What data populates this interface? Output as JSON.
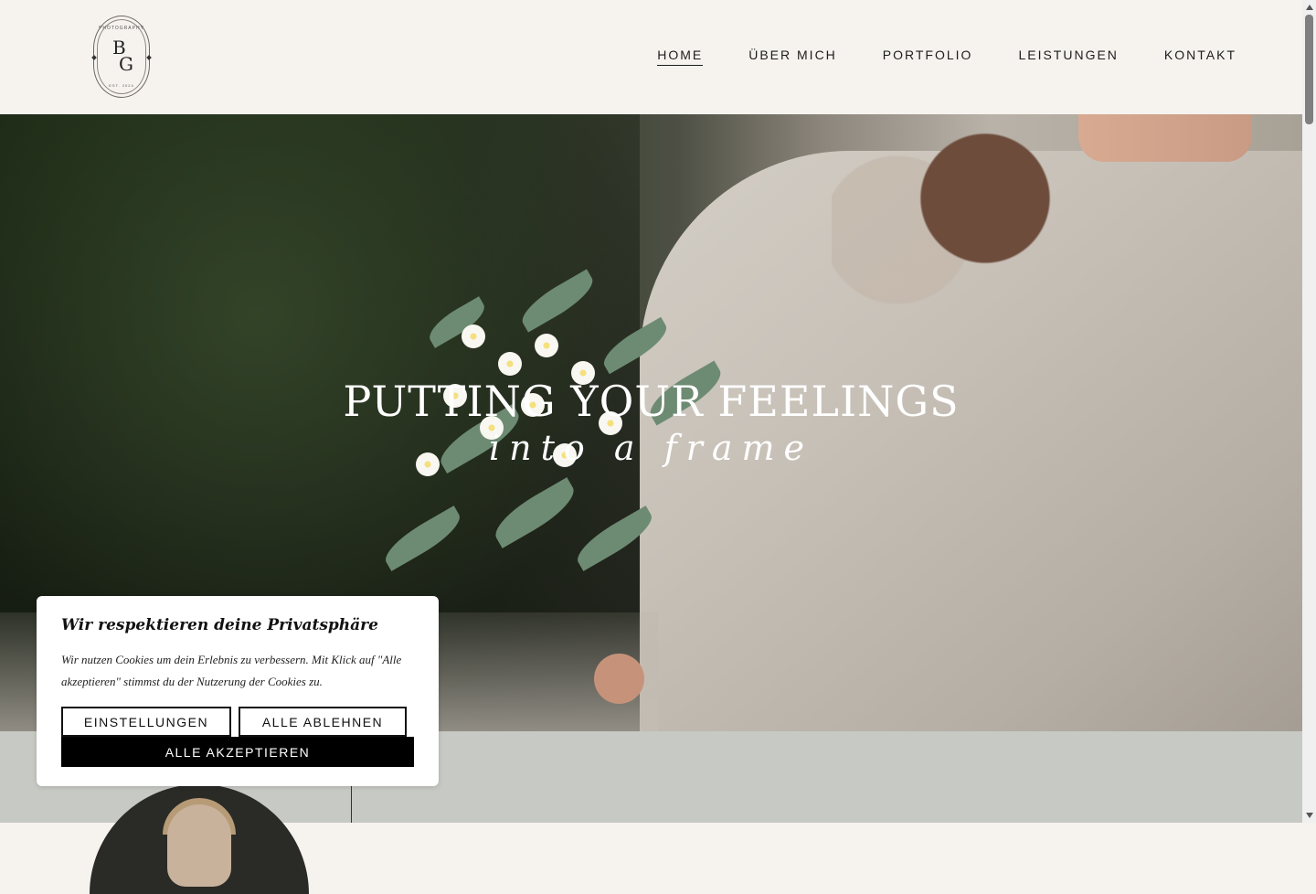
{
  "brand": {
    "logo_top": "PHOTOGRAPHY",
    "logo_initial_1": "B",
    "logo_initial_2": "G",
    "logo_bottom": "EST. 2024"
  },
  "nav": {
    "items": [
      {
        "label": "HOME",
        "active": true
      },
      {
        "label": "ÜBER MICH",
        "active": false
      },
      {
        "label": "PORTFOLIO",
        "active": false
      },
      {
        "label": "LEISTUNGEN",
        "active": false
      },
      {
        "label": "KONTAKT",
        "active": false
      }
    ]
  },
  "hero": {
    "title": "PUTTING YOUR FEELINGS",
    "subtitle": "into a frame"
  },
  "cookie": {
    "title": "Wir respektieren deine Privatsphäre",
    "text": "Wir nutzen Cookies um dein Erlebnis zu verbessern. Mit Klick auf \"Alle akzeptieren\" stimmst du der Nutzerung der Cookies zu.",
    "settings_label": "EINSTELLUNGEN",
    "reject_label": "ALLE ABLEHNEN",
    "accept_label": "ALLE AKZEPTIEREN"
  },
  "colors": {
    "header_bg": "#f6f3ef",
    "section_bg": "#c7c9c4",
    "text": "#1d1d1d",
    "accept_bg": "#000000"
  }
}
